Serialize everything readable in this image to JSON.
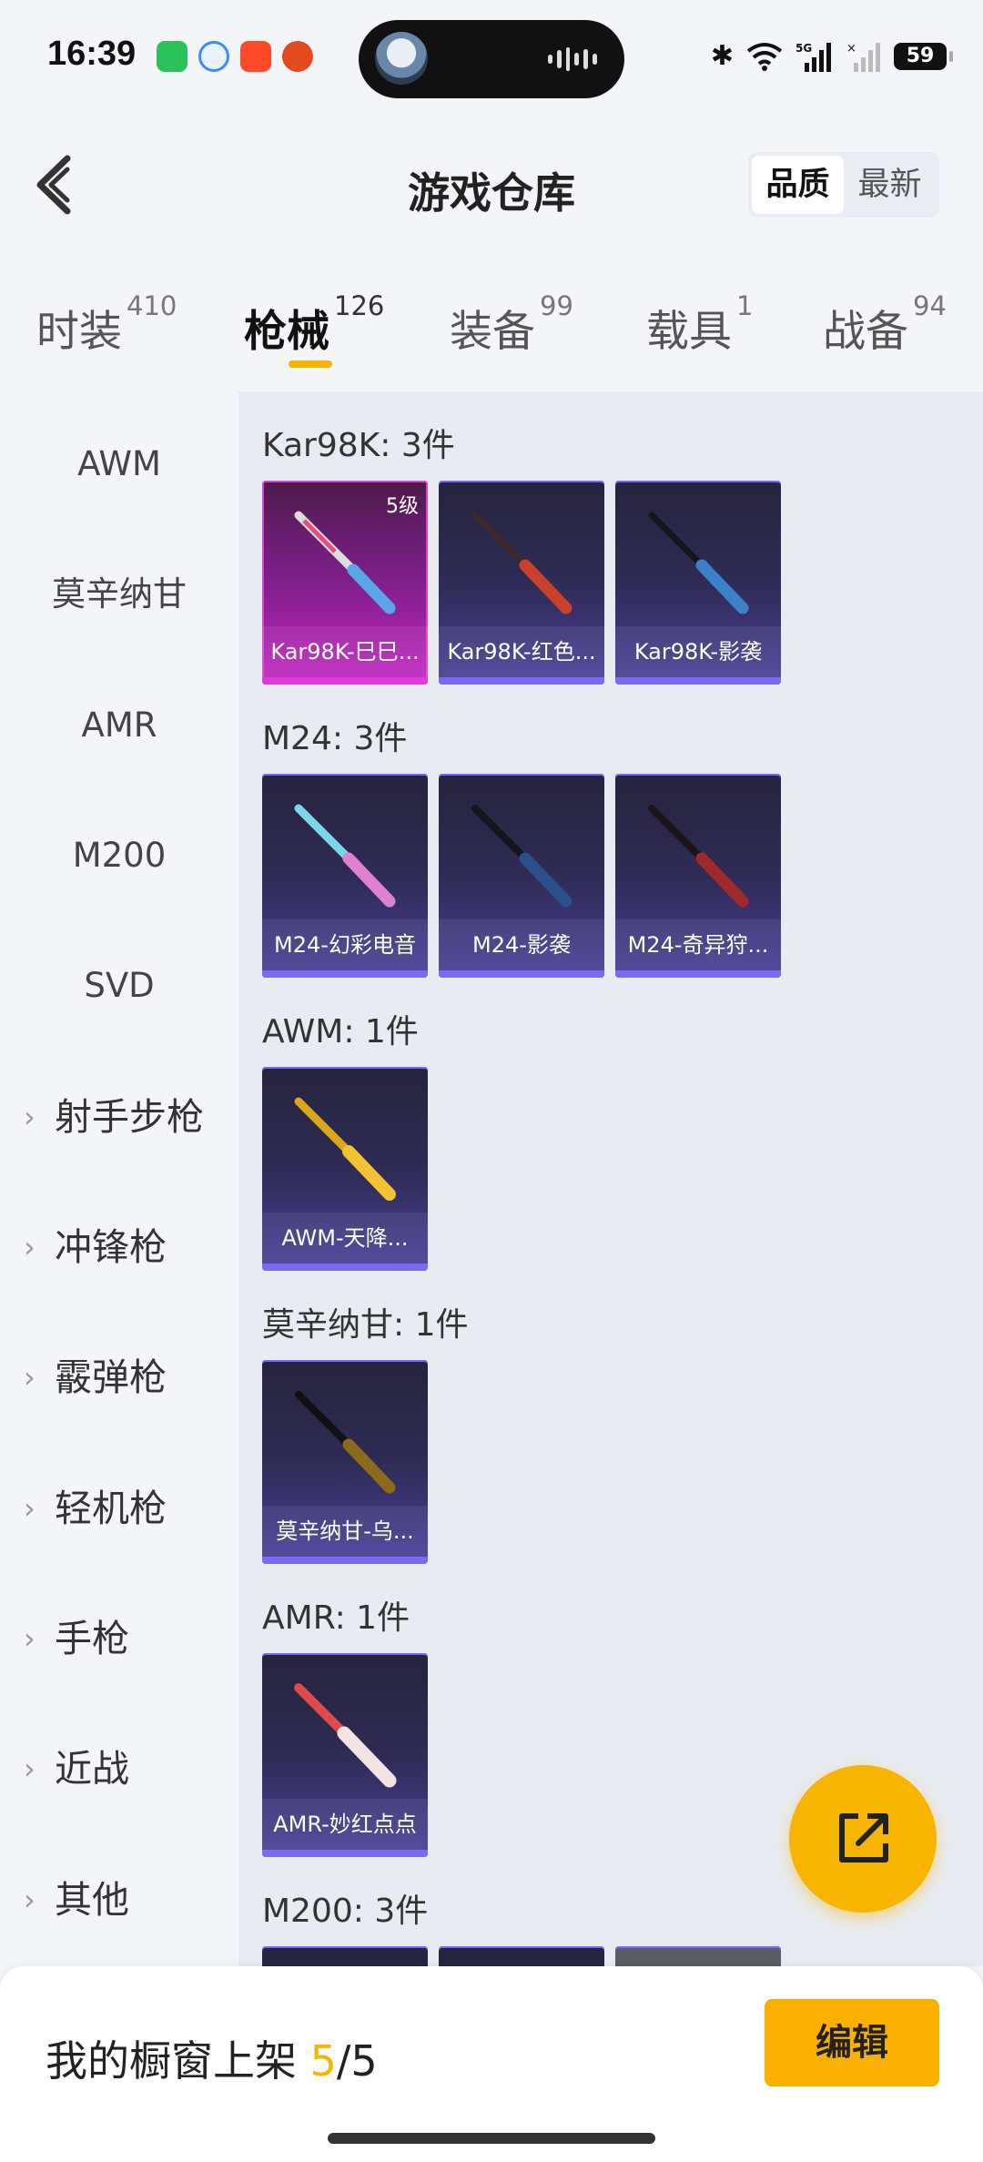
{
  "status_bar": {
    "time": "16:39",
    "battery": "59"
  },
  "header": {
    "title": "游戏仓库",
    "sort_options": [
      "品质",
      "最新"
    ],
    "sort_selected": "品质"
  },
  "tabs": [
    {
      "label": "时装",
      "count": "410"
    },
    {
      "label": "枪械",
      "count": "126"
    },
    {
      "label": "装备",
      "count": "99"
    },
    {
      "label": "载具",
      "count": "1"
    },
    {
      "label": "战备",
      "count": "94"
    }
  ],
  "active_tab": "枪械",
  "sidebar": {
    "plain_items": [
      "AWM",
      "莫辛纳甘",
      "AMR",
      "M200",
      "SVD"
    ],
    "categories": [
      "射手步枪",
      "冲锋枪",
      "霰弹枪",
      "轻机枪",
      "手枪",
      "近战",
      "其他"
    ]
  },
  "sections": [
    {
      "title": "Kar98K: 3件",
      "items": [
        {
          "name": "Kar98K-巳巳...",
          "level": "5级",
          "rarity": "legendary"
        },
        {
          "name": "Kar98K-红色...",
          "rarity": "epic"
        },
        {
          "name": "Kar98K-影袭",
          "rarity": "epic"
        }
      ]
    },
    {
      "title": "M24: 3件",
      "items": [
        {
          "name": "M24-幻彩电音",
          "rarity": "epic"
        },
        {
          "name": "M24-影袭",
          "rarity": "epic"
        },
        {
          "name": "M24-奇异狩...",
          "rarity": "epic"
        }
      ]
    },
    {
      "title": "AWM: 1件",
      "items": [
        {
          "name": "AWM-天降...",
          "rarity": "epic"
        }
      ]
    },
    {
      "title": "莫辛纳甘: 1件",
      "items": [
        {
          "name": "莫辛纳甘-乌...",
          "rarity": "epic"
        }
      ]
    },
    {
      "title": "AMR: 1件",
      "items": [
        {
          "name": "AMR-妙红点点",
          "rarity": "epic"
        }
      ]
    },
    {
      "title": "M200: 3件",
      "items": []
    }
  ],
  "bottom_bar": {
    "shelf_label": "我的橱窗上架 ",
    "shelf_current": "5",
    "shelf_total": "/5",
    "edit_label": "编辑"
  },
  "colors": {
    "accent": "#f7b500",
    "epic": "#7a6af2",
    "legendary": "#e23ad8"
  }
}
